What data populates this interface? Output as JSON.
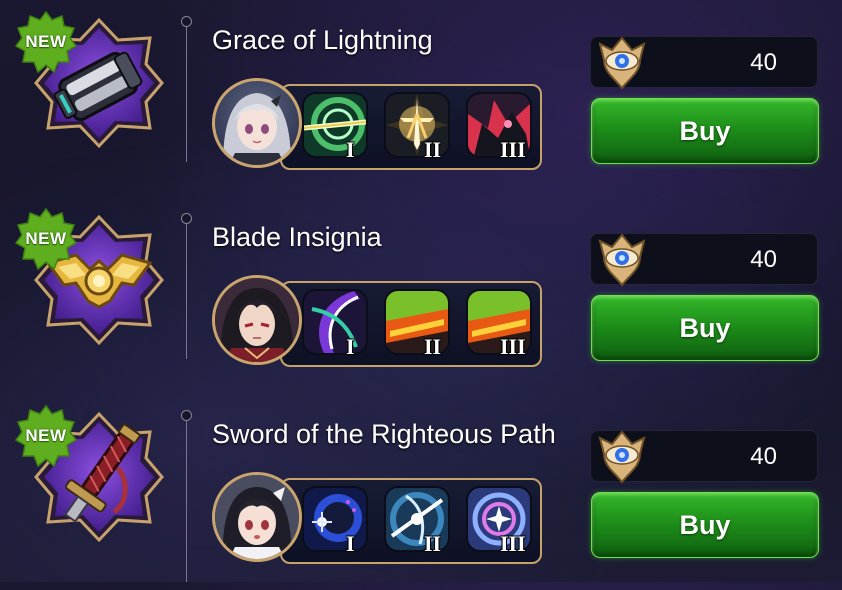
{
  "colors": {
    "accent_gold": "#c6a36b",
    "buy_green": "#2aa522",
    "new_green": "#5fae1f",
    "emblem_purple": "#5a2aa8"
  },
  "items": [
    {
      "new_label": "NEW",
      "icon": "gauntlet-icon",
      "name": "Grace of Lightning",
      "hero": "silver-haired-girl-portrait",
      "skills": [
        {
          "icon": "lightning-beam-skill-icon",
          "numeral": "I"
        },
        {
          "icon": "radiant-sword-cross-skill-icon",
          "numeral": "II"
        },
        {
          "icon": "dark-beast-skill-icon",
          "numeral": "III"
        }
      ],
      "currency_icon": "eye-gem-icon",
      "price": "40",
      "buy_label": "Buy"
    },
    {
      "new_label": "NEW",
      "icon": "golden-insignia-icon",
      "name": "Blade Insignia",
      "hero": "dark-haired-swordsman-portrait",
      "skills": [
        {
          "icon": "slash-arc-skill-icon",
          "numeral": "I"
        },
        {
          "icon": "fire-burst-skill-icon",
          "numeral": "II"
        },
        {
          "icon": "fire-burst-skill-icon",
          "numeral": "III"
        }
      ],
      "currency_icon": "eye-gem-icon",
      "price": "40",
      "buy_label": "Buy"
    },
    {
      "new_label": "NEW",
      "icon": "sword-hilt-icon",
      "name": "Sword of the Righteous Path",
      "hero": "black-haired-girl-portrait",
      "skills": [
        {
          "icon": "blue-orb-skill-icon",
          "numeral": "I"
        },
        {
          "icon": "wind-slash-skill-icon",
          "numeral": "II"
        },
        {
          "icon": "star-swirl-skill-icon",
          "numeral": "III"
        }
      ],
      "currency_icon": "eye-gem-icon",
      "price": "40",
      "buy_label": "Buy"
    }
  ]
}
